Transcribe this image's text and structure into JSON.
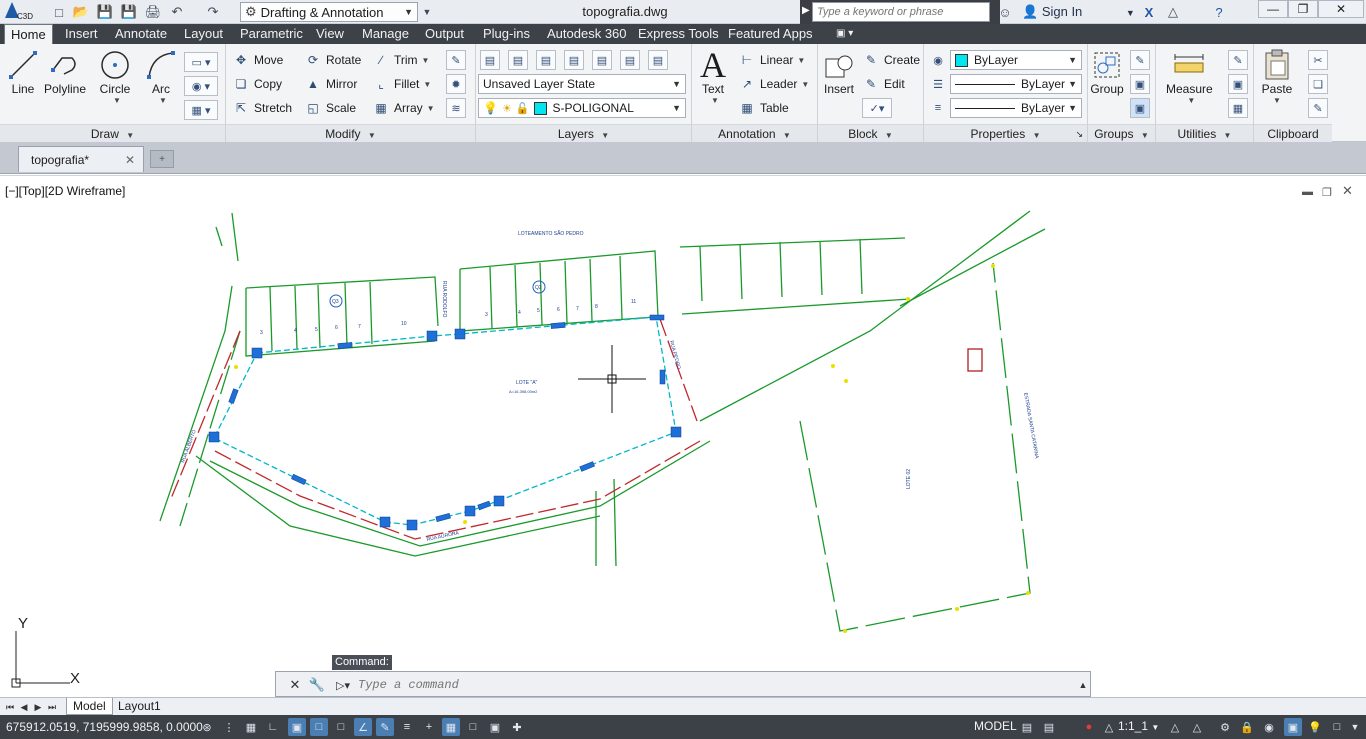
{
  "titlebar": {
    "app_badge": "C3D",
    "workspace": "Drafting & Annotation",
    "document_title": "topografia.dwg",
    "search_placeholder": "Type a keyword or phrase",
    "sign_in": "Sign In"
  },
  "ribbon_tabs": [
    "Home",
    "Insert",
    "Annotate",
    "Layout",
    "Parametric",
    "View",
    "Manage",
    "Output",
    "Plug-ins",
    "Autodesk 360",
    "Express Tools",
    "Featured Apps"
  ],
  "panels": {
    "draw": {
      "title": "Draw",
      "line": "Line",
      "polyline": "Polyline",
      "circle": "Circle",
      "arc": "Arc"
    },
    "modify": {
      "title": "Modify",
      "move": "Move",
      "rotate": "Rotate",
      "trim": "Trim",
      "copy": "Copy",
      "mirror": "Mirror",
      "fillet": "Fillet",
      "stretch": "Stretch",
      "scale": "Scale",
      "array": "Array"
    },
    "layers": {
      "title": "Layers",
      "layer_state": "Unsaved Layer State",
      "current_layer": "S-POLIGONAL"
    },
    "annotation": {
      "title": "Annotation",
      "text": "Text",
      "linear": "Linear",
      "leader": "Leader",
      "table": "Table"
    },
    "block": {
      "title": "Block",
      "insert": "Insert",
      "create": "Create",
      "edit": "Edit"
    },
    "properties": {
      "title": "Properties",
      "color": "ByLayer",
      "linetype": "ByLayer",
      "lineweight": "ByLayer"
    },
    "groups": {
      "title": "Groups",
      "group": "Group"
    },
    "utilities": {
      "title": "Utilities",
      "measure": "Measure"
    },
    "clipboard": {
      "title": "Clipboard",
      "paste": "Paste"
    }
  },
  "file_tab": "topografia*",
  "viewport": {
    "label": "[−][Top][2D Wireframe]",
    "drawing_texts": {
      "top_label": "LOTEAMENTO SÃO PEDRO",
      "lot_label": "LOTE \"A\"",
      "area_label": "A=16.398,00m2",
      "street_1": "RUA AURORA",
      "street_2": "RUA PEDRO",
      "street_3": "RUA ALBERTO",
      "street_4": "RUA RODOLFO",
      "right_label_1": "ESTRADA SANTA CATARINA",
      "right_label_2": "LOTE 02",
      "block_a": "Q3",
      "block_b": "Q2",
      "lot_numbers_left": [
        "3",
        "4",
        "5",
        "6",
        "7",
        "10"
      ],
      "lot_numbers_right": [
        "3",
        "4",
        "5",
        "6",
        "7",
        "8",
        "11"
      ]
    },
    "ucs_x": "X",
    "ucs_y": "Y"
  },
  "command": {
    "label": "Command:",
    "placeholder": "Type a command"
  },
  "layout_tabs": [
    "Model",
    "Layout1"
  ],
  "status": {
    "coordinates": "675912.0519, 7195999.9858, 0.0000",
    "model": "MODEL",
    "scale": "1:1_1"
  },
  "colors": {
    "ribbon_dark": "#3d4148",
    "polyline_green": "#1a9a2a",
    "lot_cyan": "#00b7c9",
    "grip_blue": "#1e6fd8",
    "road_red": "#c0282e"
  }
}
